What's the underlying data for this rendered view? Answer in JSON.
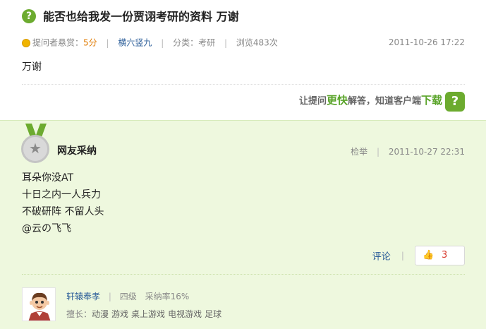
{
  "question": {
    "icon": "question-icon",
    "icon_glyph": "?",
    "title": "能否也给我发一份贾诩考研的资料 万谢",
    "meta": {
      "asker_reward_label": "提问者悬赏：",
      "reward": "5分",
      "category_link": "横六竖九",
      "category_label": "分类：",
      "category": "考研",
      "views": "浏览483次",
      "time": "2011-10-26 17:22"
    },
    "body": "万谢"
  },
  "promo": {
    "prefix": "让提问",
    "fast": "更快",
    "middle": "解答，知道客户端",
    "download": "下载"
  },
  "answer": {
    "adopted_label": "网友采纳",
    "report": "检举",
    "time": "2011-10-27 22:31",
    "lines": [
      "耳朵你没AT",
      "十日之内一人兵力",
      "不破研阵 不留人头",
      "@云の飞飞"
    ],
    "comment": "评论",
    "likes": "3"
  },
  "user": {
    "name": "轩辕奉孝",
    "level": "四级",
    "adoption_rate": "采纳率16%",
    "skills_label": "擅长：",
    "skills": [
      "动漫",
      "游戏",
      "桌上游戏",
      "电视游戏",
      "足球"
    ]
  },
  "colors": {
    "accent_green": "#6cab2f",
    "answer_bg": "#eef8de",
    "link_blue": "#2d5f9a",
    "reward_orange": "#e07a00"
  }
}
